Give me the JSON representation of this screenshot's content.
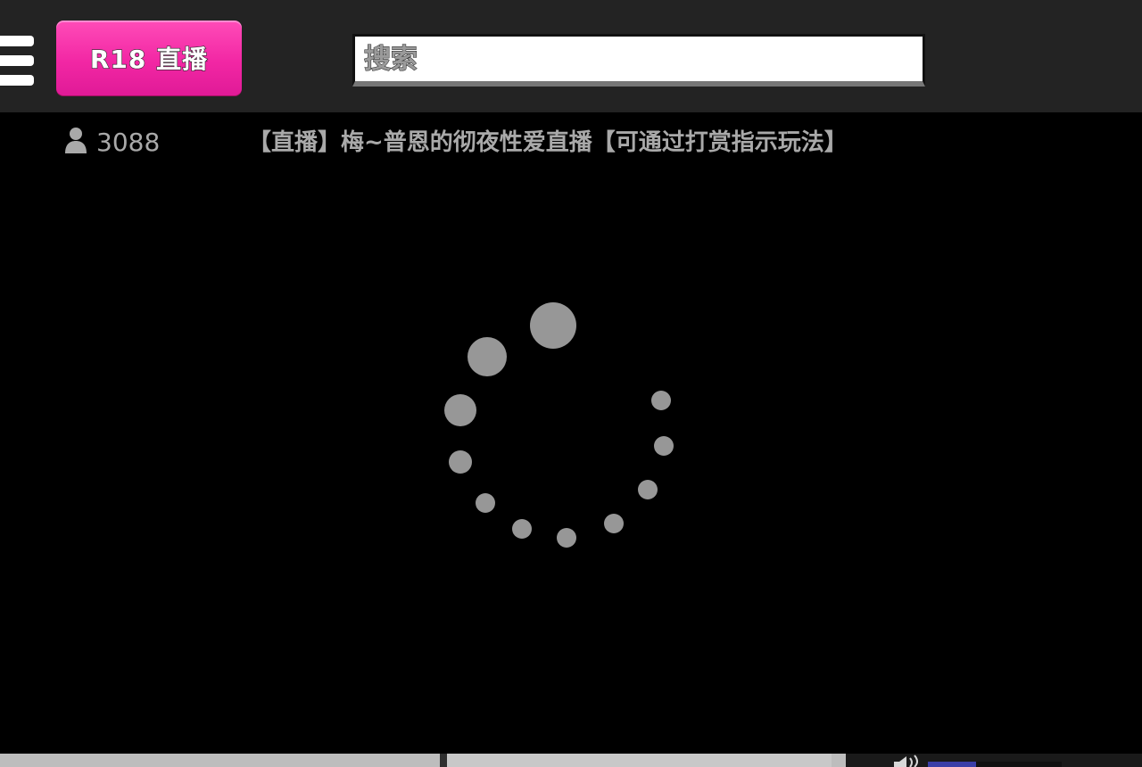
{
  "header": {
    "brand_label": "R18 直播",
    "brand_color": "#f227a4",
    "search": {
      "placeholder": "搜索",
      "value": ""
    }
  },
  "stream": {
    "viewer_count": "3088",
    "title": "【直播】梅~普恩的彻夜性爱直播【可通过打赏指示玩法】"
  },
  "player": {
    "state": "loading",
    "progress_fraction": 0.52,
    "buffered_fraction": 0.74,
    "volume_fraction": 0.36
  },
  "icons": {
    "menu": "hamburger-menu-icon",
    "viewer": "person-icon",
    "loading": "loading-spinner-icon",
    "volume": "speaker-icon"
  }
}
